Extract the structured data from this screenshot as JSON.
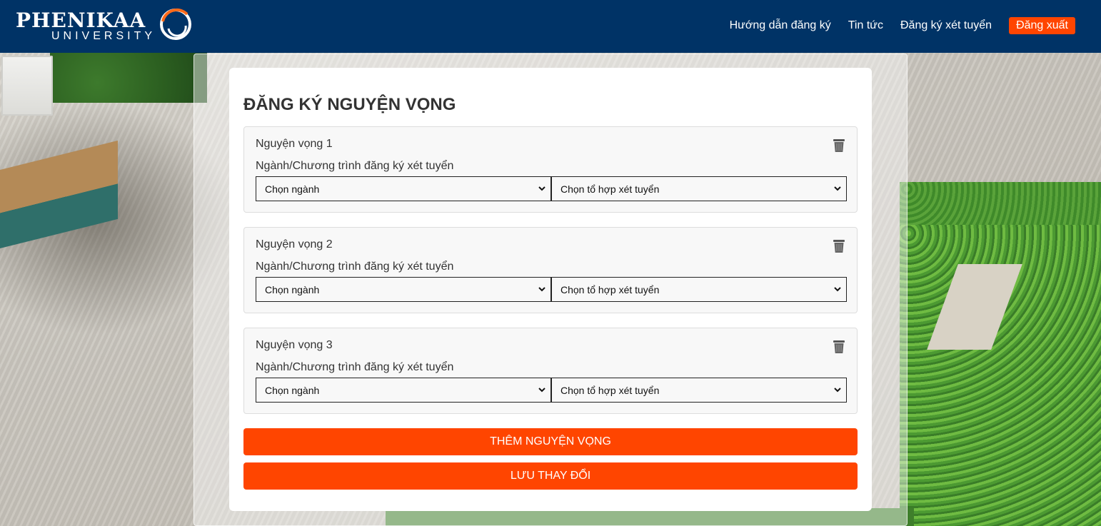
{
  "colors": {
    "header_bg": "#003366",
    "accent": "#ff4500",
    "card_bg": "#ffffff",
    "wish_bg": "#f8f8f8"
  },
  "header": {
    "logo_text": "PHENIKAA",
    "logo_subtext": "UNIVERSITY",
    "nav": {
      "guide": "Hướng dẫn đăng ký",
      "news": "Tin tức",
      "register": "Đăng ký xét tuyển",
      "logout": "Đăng xuất"
    }
  },
  "form": {
    "title": "ĐĂNG KÝ NGUYỆN VỌNG",
    "wishes": [
      {
        "label": "Nguyện vọng 1",
        "field_label": "Ngành/Chương trình đăng ký xét tuyển",
        "major_select": "Chọn ngành",
        "combo_select": "Chọn tổ hợp xét tuyển",
        "delete_icon": "trash-icon"
      },
      {
        "label": "Nguyện vọng 2",
        "field_label": "Ngành/Chương trình đăng ký xét tuyển",
        "major_select": "Chọn ngành",
        "combo_select": "Chọn tổ hợp xét tuyển",
        "delete_icon": "trash-icon"
      },
      {
        "label": "Nguyện vọng 3",
        "field_label": "Ngành/Chương trình đăng ký xét tuyển",
        "major_select": "Chọn ngành",
        "combo_select": "Chọn tổ hợp xét tuyển",
        "delete_icon": "trash-icon"
      }
    ],
    "add_button": "THÊM NGUYỆN VỌNG",
    "save_button": "LƯU THAY ĐỔI"
  }
}
